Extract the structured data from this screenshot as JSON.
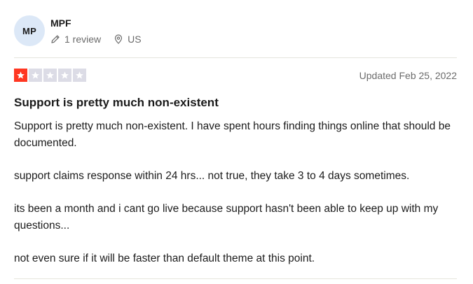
{
  "reviewer": {
    "initials": "MP",
    "name": "MPF",
    "review_count": "1 review",
    "location": "US",
    "avatar_color": "#dce8f7"
  },
  "rating": {
    "stars": 1,
    "max_stars": 5,
    "star_color": "#ff3722",
    "empty_color": "#dcdce6"
  },
  "updated": "Updated Feb 25, 2022",
  "review": {
    "title": "Support is pretty much non-existent",
    "paragraphs": [
      "Support is pretty much non-existent. I have spent hours finding things online that should be documented.",
      "support claims response within 24 hrs... not true, they take 3 to 4 days sometimes.",
      "its been a month and i cant go live because support hasn't been able to keep up with my questions...",
      "not even sure if it will be faster than default theme at this point."
    ]
  },
  "icons": {
    "review_icon": "pencil-icon",
    "location_icon": "location-pin-icon",
    "star_icon": "star-icon"
  }
}
